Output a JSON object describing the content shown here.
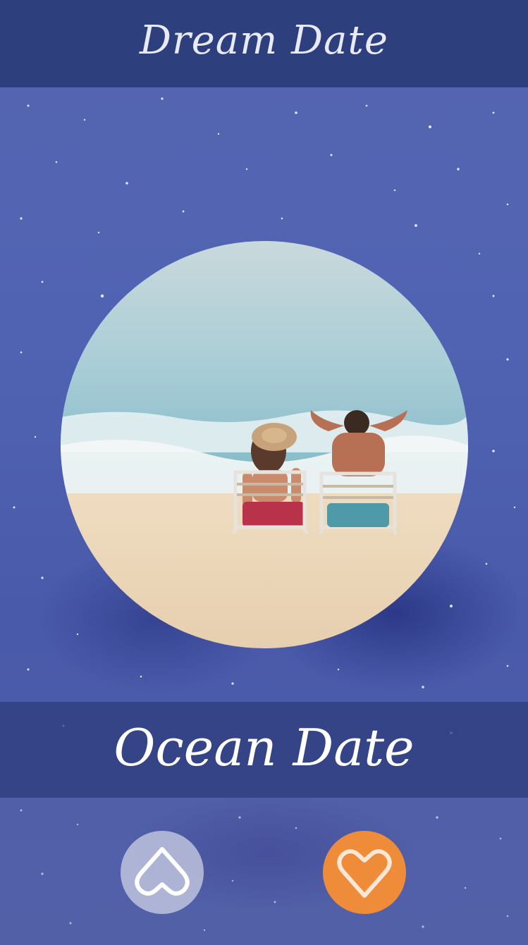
{
  "header": {
    "title": "Dream Date"
  },
  "card": {
    "title": "Ocean Date",
    "photo_icon": "beach-couple-photo"
  },
  "actions": {
    "skip_icon": "heart-outline-inverted-icon",
    "like_icon": "heart-outline-icon",
    "like_color": "#ef8c3a",
    "skip_color": "#c8cce1"
  }
}
